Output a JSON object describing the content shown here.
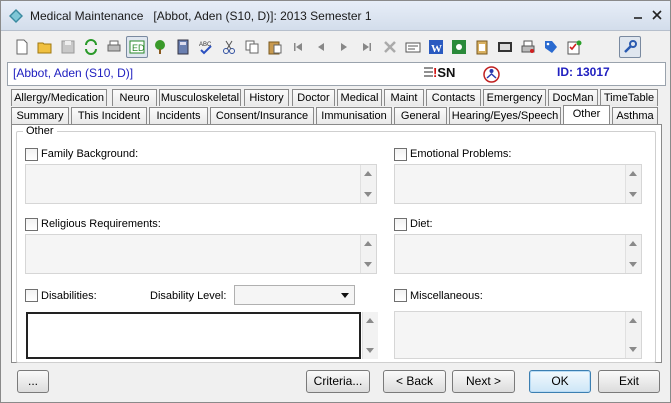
{
  "window": {
    "title": "Medical Maintenance   [Abbot, Aden (S10, D)]: 2013 Semester 1",
    "icon": "diamond-app-icon"
  },
  "toolbar": {
    "items": [
      "new-icon",
      "open-folder-icon",
      "save-icon",
      "refresh-icon",
      "print-icon",
      "edit-icon",
      "tree-icon",
      "calculator-icon",
      "spellcheck-icon",
      "cut-icon",
      "copy-icon",
      "paste-icon",
      "first-record-icon",
      "previous-record-icon",
      "next-record-icon",
      "last-record-icon",
      "delete-icon",
      "card-icon",
      "word-icon",
      "excel-icon",
      "clipboard-icon",
      "film-icon",
      "print-setup-icon",
      "tag-icon",
      "checklist-icon",
      "tools-icon"
    ]
  },
  "infobar": {
    "student": "[Abbot, Aden (S10, D)]",
    "flag_bang": "!",
    "flag_text": "SN",
    "id_label": "ID: 13017"
  },
  "tabs": {
    "row1": [
      "Allergy/Medication",
      "Neuro",
      "Musculoskeletal",
      "History",
      "Doctor",
      "Medical",
      "Maint",
      "Contacts",
      "Emergency",
      "DocMan",
      "TimeTable"
    ],
    "row2": [
      "Summary",
      "This Incident",
      "Incidents",
      "Consent/Insurance",
      "Immunisation",
      "General",
      "Hearing/Eyes/Speech",
      "Other",
      "Asthma"
    ],
    "active": "Other"
  },
  "other": {
    "group_label": "Other",
    "family_background": "Family Background:",
    "religious_requirements": "Religious Requirements:",
    "disabilities": "Disabilities:",
    "disability_level": "Disability Level:",
    "emotional_problems": "Emotional Problems:",
    "diet": "Diet:",
    "miscellaneous": "Miscellaneous:"
  },
  "buttons": {
    "more": "...",
    "criteria": "Criteria...",
    "back": "< Back",
    "next": "Next >",
    "ok": "OK",
    "exit": "Exit"
  },
  "colors": {
    "student_text": "#2020c0",
    "flag_red": "#d01010"
  }
}
